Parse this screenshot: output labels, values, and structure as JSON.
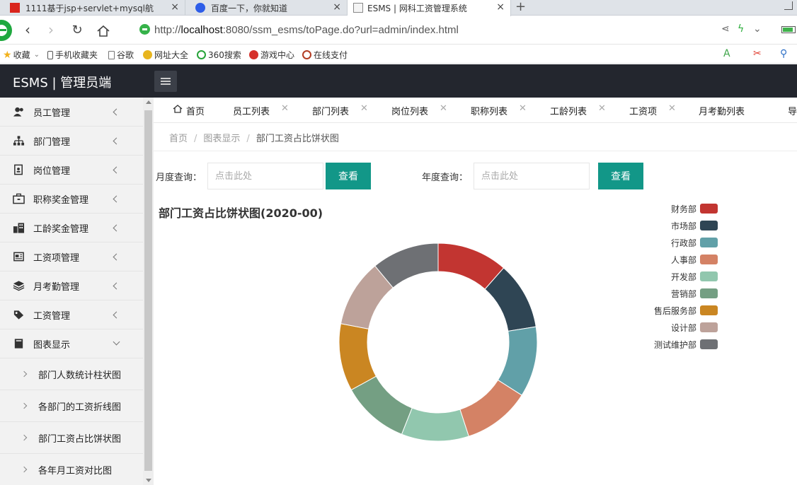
{
  "browser": {
    "tabs": [
      {
        "label": "1111基于jsp+servlet+mysql航",
        "active": false
      },
      {
        "label": "百度一下，你就知道",
        "active": false
      },
      {
        "label": "ESMS | 网科工资管理系统",
        "active": true
      }
    ],
    "url_prefix": "http://",
    "url_host": "localhost",
    "url_rest": ":8080/ssm_esms/toPage.do?url=admin/index.html",
    "bookmarks": [
      "收藏",
      "手机收藏夹",
      "谷歌",
      "网址大全",
      "360搜索",
      "游戏中心",
      "在线支付"
    ]
  },
  "app": {
    "title": "ESMS | 管理员端"
  },
  "sidebar": {
    "items": [
      {
        "label": "员工管理",
        "icon": "users-icon"
      },
      {
        "label": "部门管理",
        "icon": "sitemap-icon"
      },
      {
        "label": "岗位管理",
        "icon": "id-card-icon"
      },
      {
        "label": "职称奖金管理",
        "icon": "briefcase-icon"
      },
      {
        "label": "工龄奖金管理",
        "icon": "building-icon"
      },
      {
        "label": "工资项管理",
        "icon": "newspaper-icon"
      },
      {
        "label": "月考勤管理",
        "icon": "layers-icon"
      },
      {
        "label": "工资管理",
        "icon": "tag-icon"
      },
      {
        "label": "图表显示",
        "icon": "book-icon"
      }
    ],
    "subitems": [
      "部门人数统计柱状图",
      "各部门的工资折线图",
      "部门工资占比饼状图",
      "各年月工资对比图"
    ]
  },
  "pagetabs": [
    "首页",
    "员工列表",
    "部门列表",
    "岗位列表",
    "职称列表",
    "工龄列表",
    "工资项",
    "月考勤列表",
    "导"
  ],
  "breadcrumb": [
    "首页",
    "图表显示",
    "部门工资占比饼状图"
  ],
  "query": {
    "month_label": "月度查询：",
    "month_placeholder": "点击此处",
    "year_label": "年度查询：",
    "year_placeholder": "点击此处",
    "button_label": "查看"
  },
  "colors": {
    "accent": "#129788",
    "header": "#23262e"
  },
  "chart_data": {
    "type": "pie",
    "title": "部门工资占比饼状图(2020-00)",
    "donut": true,
    "legend_position": "top-right",
    "categories": [
      "财务部",
      "市场部",
      "行政部",
      "人事部",
      "开发部",
      "营销部",
      "售后服务部",
      "设计部",
      "测试维护部"
    ],
    "values": [
      11.5,
      11,
      11.5,
      11,
      11,
      11,
      11,
      11,
      11
    ],
    "colors": [
      "#c23531",
      "#2f4554",
      "#61a0a8",
      "#d48265",
      "#91c7ae",
      "#749f83",
      "#ca8622",
      "#bda29a",
      "#6e7074"
    ]
  }
}
